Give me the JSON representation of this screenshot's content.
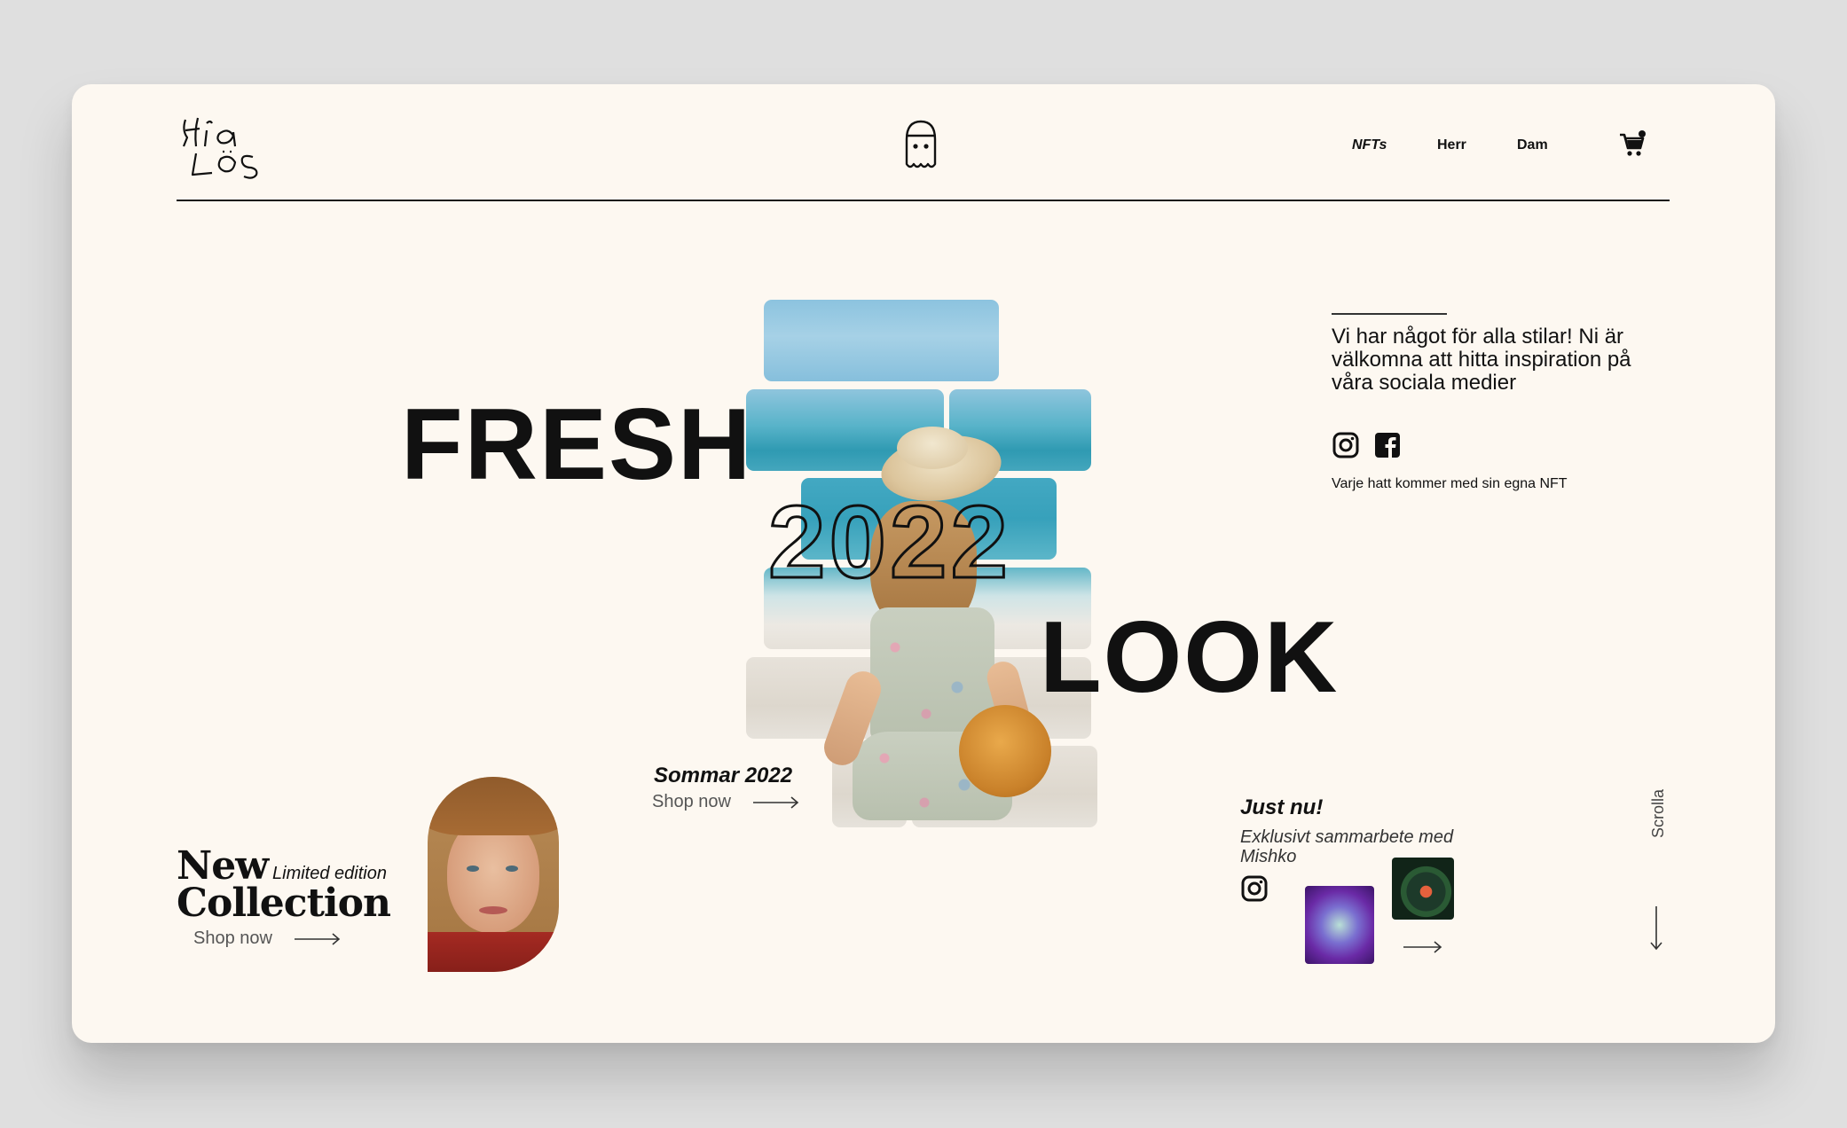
{
  "header": {
    "logo_text": "Hia Lös",
    "nav": [
      "NFTs",
      "Herr",
      "Dam"
    ],
    "cart_icon": "cart-icon",
    "center_icon": "ghost-cap-icon"
  },
  "hero": {
    "word1": "FRESH",
    "year": "2022",
    "word2": "LOOK"
  },
  "info": {
    "text": "Vi har något för alla stilar! Ni är välkomna att hitta inspiration på våra sociala medier",
    "note": "Varje hatt kommer med sin egna NFT",
    "icons": [
      "instagram-icon",
      "facebook-icon"
    ]
  },
  "sommar": {
    "title": "Sommar 2022",
    "shop": "Shop now"
  },
  "collection": {
    "new": "New",
    "limited": "Limited edition",
    "collection": "Collection",
    "shop": "Shop now"
  },
  "just": {
    "title": "Just nu!",
    "text": "Exklusivt sammarbete med Mishko"
  },
  "scroll": {
    "label": "Scrolla"
  },
  "colors": {
    "background": "#dfdfdf",
    "card": "#fdf8f1",
    "text": "#111111"
  }
}
